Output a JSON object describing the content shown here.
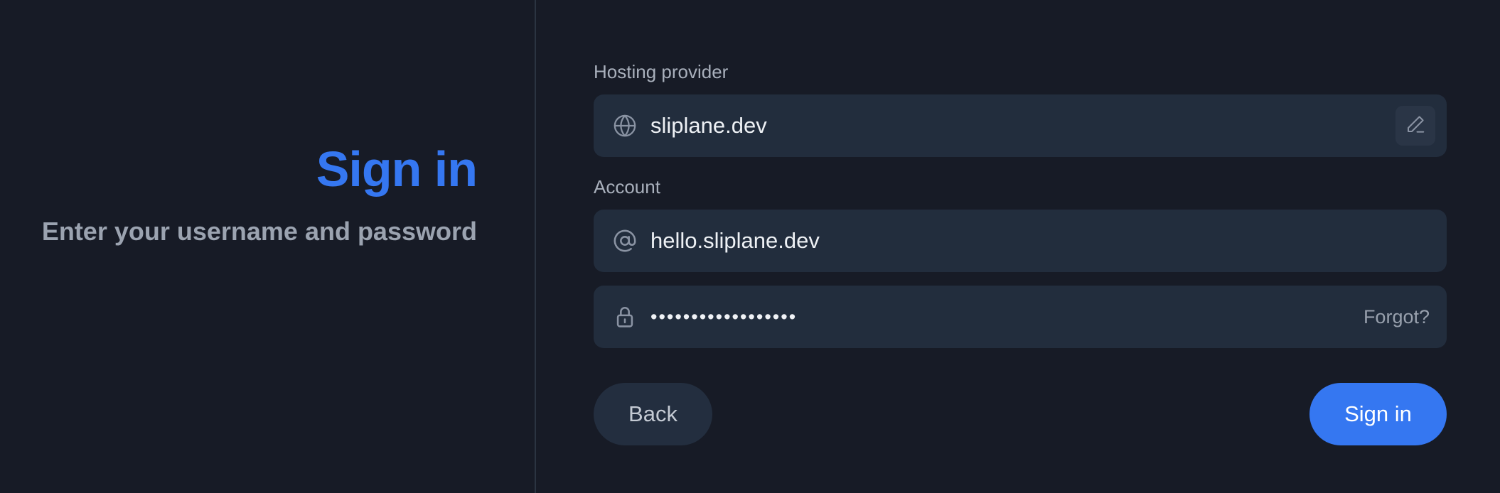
{
  "header": {
    "title": "Sign in",
    "subtitle": "Enter your username and password"
  },
  "form": {
    "hosting": {
      "label": "Hosting provider",
      "value": "sliplane.dev",
      "icon": "globe-icon",
      "edit_icon": "pencil-icon"
    },
    "account": {
      "label": "Account",
      "value": "hello.sliplane.dev",
      "icon": "at-sign-icon"
    },
    "password": {
      "masked_value": "••••••••••••••••••",
      "forgot_label": "Forgot?",
      "icon": "lock-icon"
    }
  },
  "actions": {
    "back_label": "Back",
    "signin_label": "Sign in"
  },
  "colors": {
    "background": "#171b26",
    "field_background": "#222d3d",
    "accent": "#3577f1",
    "divider": "#2b3441"
  }
}
